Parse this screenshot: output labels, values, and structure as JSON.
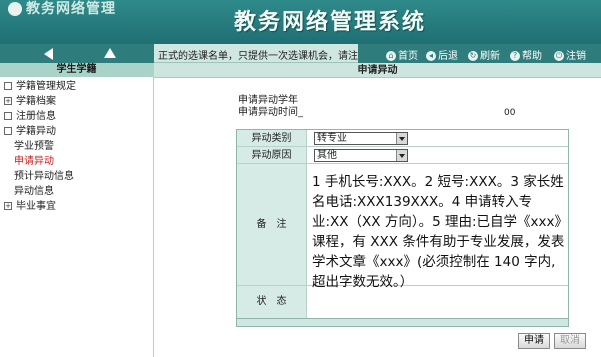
{
  "header": {
    "logo_text": "教务网络管理",
    "system_title": "教务网络管理系统"
  },
  "navbar": {
    "notice": "正式的选课名单，只提供一次选课机会，请注意!",
    "toolbar": [
      {
        "icon": "home-icon",
        "label": "首页"
      },
      {
        "icon": "back-icon",
        "label": "后退"
      },
      {
        "icon": "refresh-icon",
        "label": "刷新"
      },
      {
        "icon": "help-icon",
        "label": "帮助"
      },
      {
        "icon": "logout-icon",
        "label": "注销"
      }
    ]
  },
  "sidebar": {
    "title": "学生学籍",
    "items": [
      {
        "label": "学籍管理规定",
        "level": "top",
        "expander": "□"
      },
      {
        "label": "学籍档案",
        "level": "top",
        "expander": "+"
      },
      {
        "label": "注册信息",
        "level": "top",
        "expander": "□"
      },
      {
        "label": "学籍异动",
        "level": "top",
        "expander": "□"
      },
      {
        "label": "学业预警",
        "level": "sub"
      },
      {
        "label": "申请异动",
        "level": "sub",
        "active": true
      },
      {
        "label": "预计异动信息",
        "level": "sub"
      },
      {
        "label": "异动信息",
        "level": "sub"
      },
      {
        "label": "毕业事宜",
        "level": "top",
        "expander": "+"
      }
    ]
  },
  "main": {
    "title": "申请异动",
    "apply_year_label": "申请异动学年",
    "apply_time_label": "申请异动时间_",
    "apply_time_tail": "00",
    "form": {
      "change_type_label": "异动类别",
      "change_type_value": "转专业",
      "change_reason_label": "异动原因",
      "change_reason_value": "其他",
      "remark_label": "备　注",
      "remark_text": "1 手机长号:XXX。2 短号:XXX。3 家长姓名电话:XXX139XXX。4 申请转入专业:XX（XX 方向）。5 理由:已自学《xxx》课程，有 XXX 条件有助于专业发展，发表学术文章《xxx》(必须控制在 140 字内,超出字数无效。）",
      "status_label": "状　态"
    },
    "apply_button": "申请",
    "cancel_button": "取消"
  }
}
